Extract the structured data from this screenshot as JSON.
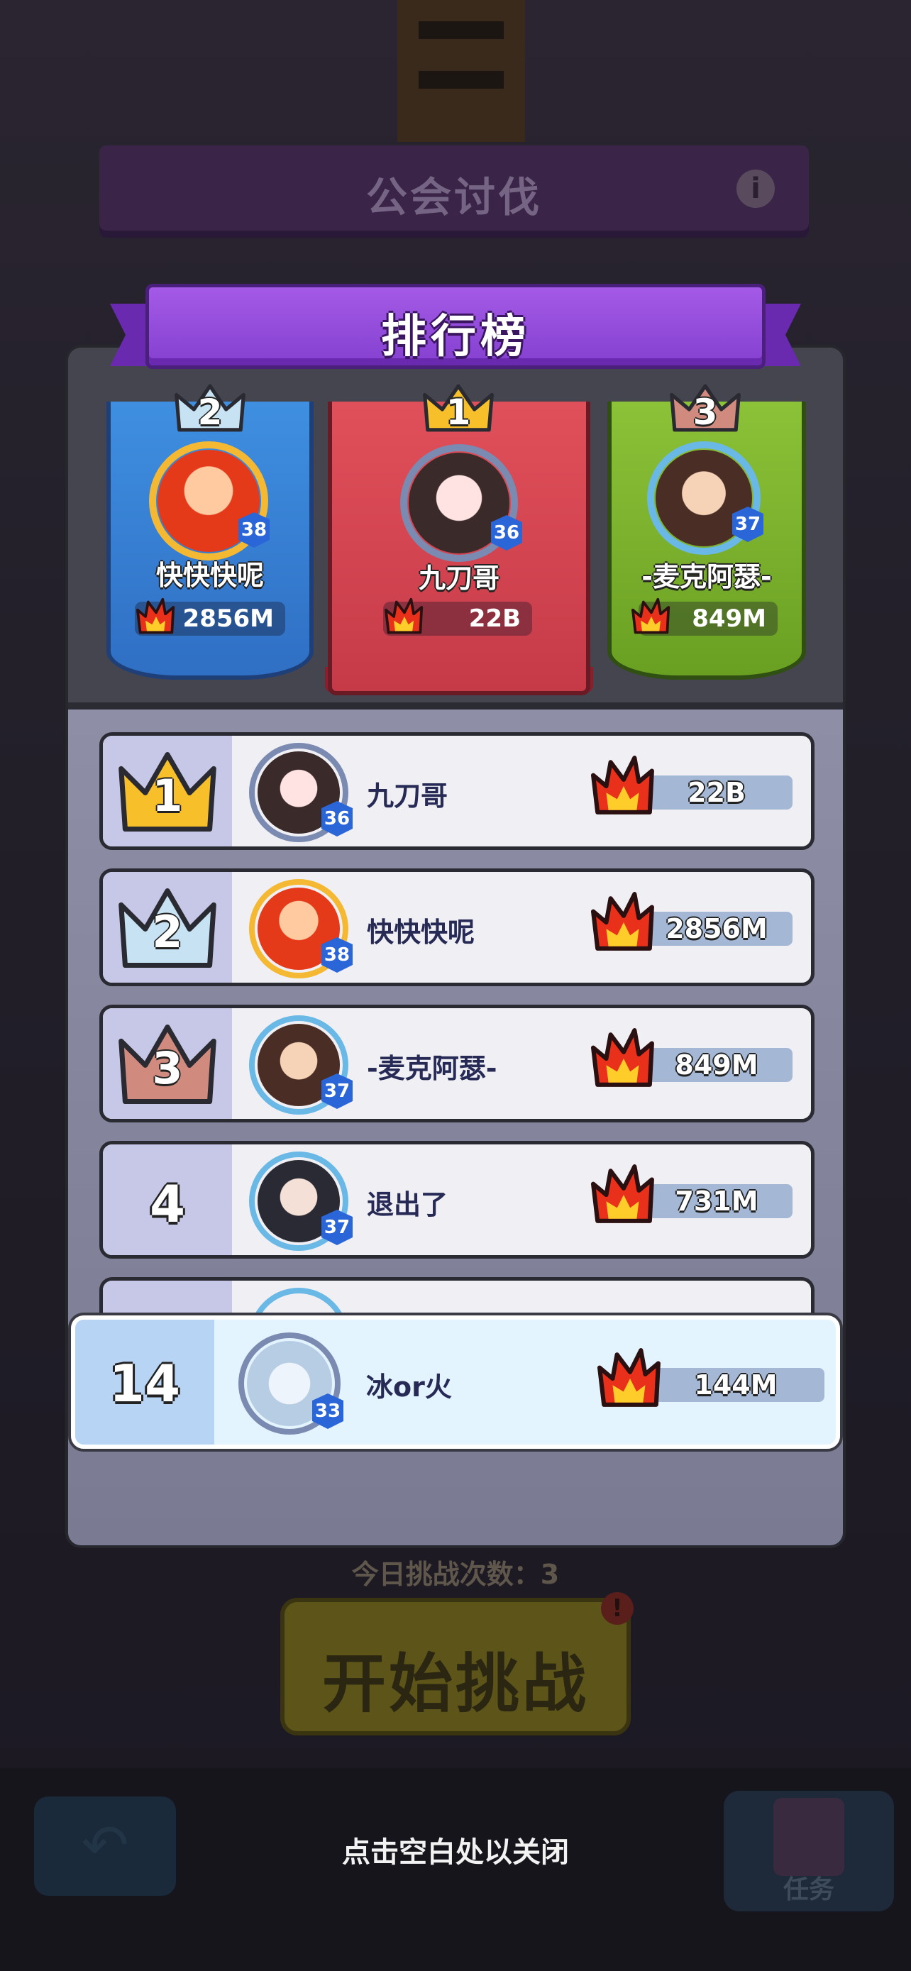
{
  "background": {
    "title": "公会讨伐",
    "info_icon": "i",
    "challenge_count": "今日挑战次数：3",
    "start_button": "开始挑战",
    "start_badge": "!",
    "back_icon": "↶",
    "task_label": "任务"
  },
  "modal": {
    "title": "排行榜",
    "close_hint": "点击空白处以关闭"
  },
  "podium": [
    {
      "rank": "2",
      "name": "快快快呢",
      "score": "2856M",
      "level": "38"
    },
    {
      "rank": "1",
      "name": "九刀哥",
      "score": "22B",
      "level": "36"
    },
    {
      "rank": "3",
      "name": "-麦克阿瑟-",
      "score": "849M",
      "level": "37"
    }
  ],
  "rows": [
    {
      "rank": "1",
      "name": "九刀哥",
      "score": "22B",
      "level": "36"
    },
    {
      "rank": "2",
      "name": "快快快呢",
      "score": "2856M",
      "level": "38"
    },
    {
      "rank": "3",
      "name": "-麦克阿瑟-",
      "score": "849M",
      "level": "37"
    },
    {
      "rank": "4",
      "name": "退出了",
      "score": "731M",
      "level": "37"
    }
  ],
  "self": {
    "rank": "14",
    "name": "冰or火",
    "score": "144M",
    "level": "33"
  },
  "colors": {
    "gold": "#f4b832",
    "silver": "#b8d8ec",
    "bronze": "#c98478",
    "purple": "#8440d0",
    "flame": "#e8301a"
  }
}
